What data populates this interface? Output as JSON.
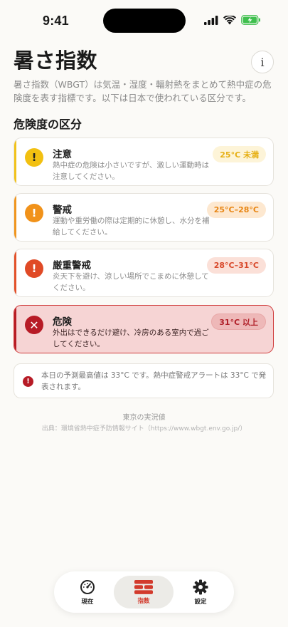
{
  "status_bar": {
    "time": "9:41"
  },
  "header": {
    "title": "暑さ指数",
    "info_label": "i"
  },
  "intro": "暑さ指数（WBGT）は気温・湿度・輻射熱をまとめて熱中症の危険度を表す指標です。以下は日本で使われている区分です。",
  "section_title": "危険度の区分",
  "levels": [
    {
      "title": "注意",
      "description": "熱中症の危険は小さいですが、激しい運動時は注意してください。",
      "range": "25°C 未満",
      "icon": "exclamation-icon",
      "color": "#f2c011"
    },
    {
      "title": "警戒",
      "description": "運動や重労働の際は定期的に休憩し、水分を補給してください。",
      "range": "25°C–28°C",
      "icon": "exclamation-icon",
      "color": "#f1921a"
    },
    {
      "title": "厳重警戒",
      "description": "炎天下を避け、涼しい場所でこまめに休憩してください。",
      "range": "28°C–31°C",
      "icon": "exclamation-icon",
      "color": "#e04a26"
    },
    {
      "title": "危険",
      "description": "外出はできるだけ避け、冷房のある室内で過ごしてください。",
      "range": "31°C 以上",
      "icon": "close-icon",
      "color": "#b71b26"
    }
  ],
  "alert_note": {
    "text": "本日の予測最高値は 33°C です。熱中症警戒アラートは 33°C で発表されます。",
    "icon": "exclamation-icon"
  },
  "source": {
    "title": "東京の実況値",
    "url": "出典：環境省熱中症予防情報サイト（https://www.wbgt.env.go.jp/）"
  },
  "tabs": [
    {
      "label": "現在",
      "icon": "gauge-icon"
    },
    {
      "label": "指数",
      "icon": "grid-icon",
      "active": true
    },
    {
      "label": "設定",
      "icon": "gear-icon"
    }
  ]
}
